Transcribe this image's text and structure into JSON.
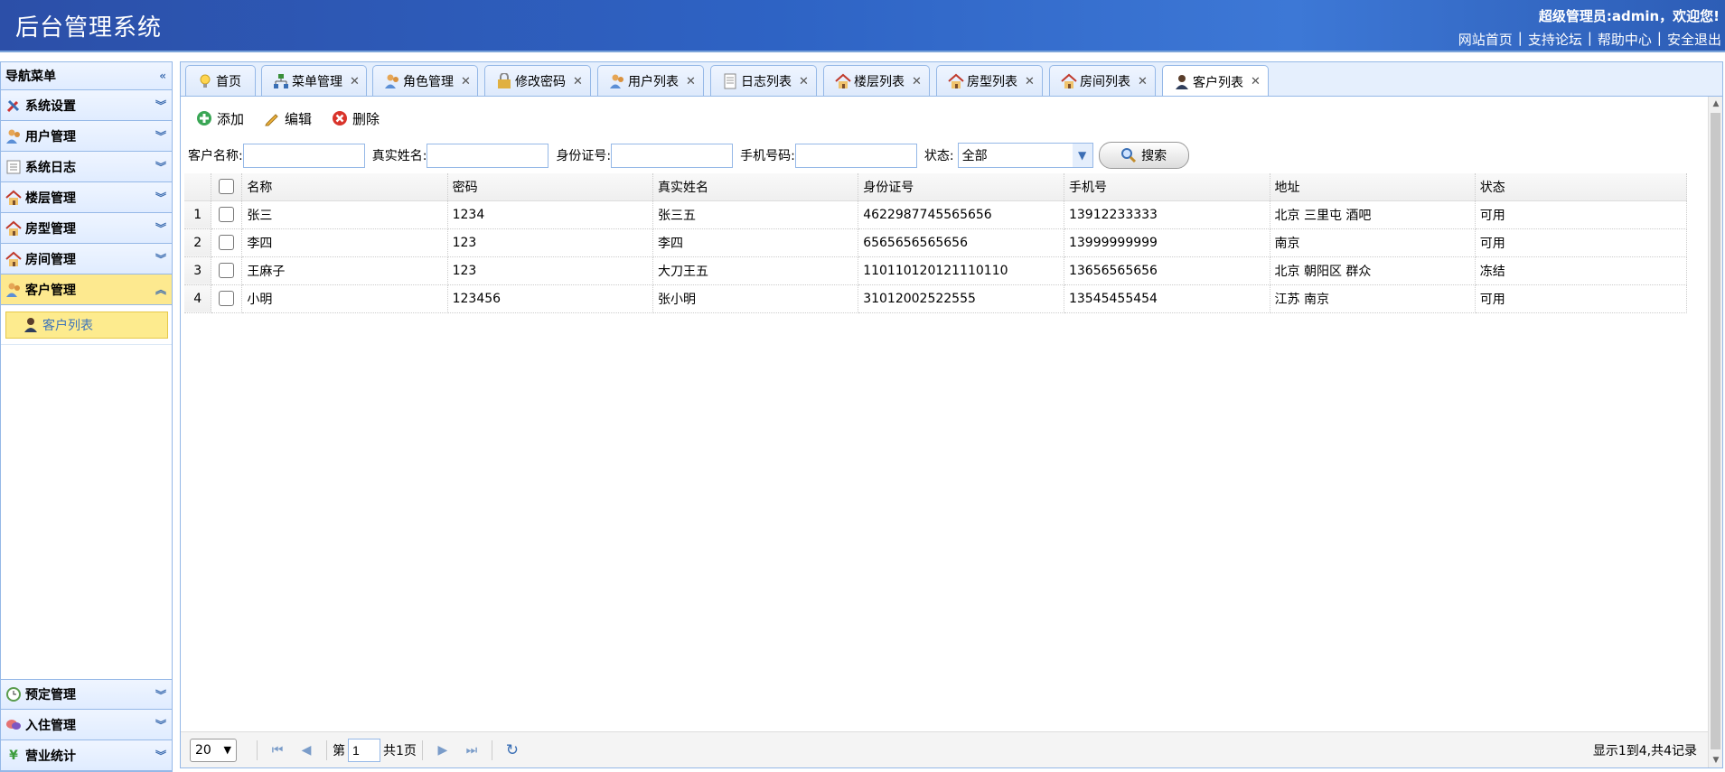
{
  "header": {
    "title": "后台管理系统",
    "welcome": "超级管理员:admin，欢迎您!",
    "links": [
      "网站首页",
      "支持论坛",
      "帮助中心",
      "安全退出"
    ]
  },
  "sidebar": {
    "title": "导航菜单",
    "items": [
      {
        "label": "系统设置",
        "icon": "tools-icon"
      },
      {
        "label": "用户管理",
        "icon": "user-group-icon"
      },
      {
        "label": "系统日志",
        "icon": "log-icon"
      },
      {
        "label": "楼层管理",
        "icon": "house-icon"
      },
      {
        "label": "房型管理",
        "icon": "house-icon"
      },
      {
        "label": "房间管理",
        "icon": "house-icon"
      },
      {
        "label": "客户管理",
        "icon": "user-group-icon"
      }
    ],
    "sub_item": "客户列表",
    "bottom_items": [
      {
        "label": "预定管理",
        "icon": "clock-icon"
      },
      {
        "label": "入住管理",
        "icon": "chat-icon"
      },
      {
        "label": "营业统计",
        "icon": "yen-icon"
      }
    ]
  },
  "tabs": [
    "首页",
    "菜单管理",
    "角色管理",
    "修改密码",
    "用户列表",
    "日志列表",
    "楼层列表",
    "房型列表",
    "房间列表",
    "客户列表"
  ],
  "toolbar": {
    "add": "添加",
    "edit": "编辑",
    "delete": "删除"
  },
  "search": {
    "customer_name": "客户名称:",
    "real_name": "真实姓名:",
    "id_number": "身份证号:",
    "phone": "手机号码:",
    "status": "状态:",
    "status_value": "全部",
    "button": "搜索"
  },
  "table": {
    "columns": [
      "名称",
      "密码",
      "真实姓名",
      "身份证号",
      "手机号",
      "地址",
      "状态"
    ],
    "rows": [
      {
        "n": "1",
        "cells": [
          "张三",
          "1234",
          "张三五",
          "4622987745565656",
          "13912233333",
          "北京 三里屯 酒吧",
          "可用"
        ]
      },
      {
        "n": "2",
        "cells": [
          "李四",
          "123",
          "李四",
          "6565656565656",
          "13999999999",
          "南京",
          "可用"
        ]
      },
      {
        "n": "3",
        "cells": [
          "王麻子",
          "123",
          "大刀王五",
          "110110120121110110",
          "13656565656",
          "北京 朝阳区 群众",
          "冻结"
        ]
      },
      {
        "n": "4",
        "cells": [
          "小明",
          "123456",
          "张小明",
          "31012002522555",
          "13545455454",
          "江苏 南京",
          "可用"
        ]
      }
    ]
  },
  "pager": {
    "page_size": "20",
    "page_prefix": "第",
    "page_value": "1",
    "page_total": "共1页",
    "info": "显示1到4,共4记录"
  },
  "colors": {
    "header": "#2e63c4",
    "active": "#fde98f",
    "border": "#95b8e7"
  }
}
